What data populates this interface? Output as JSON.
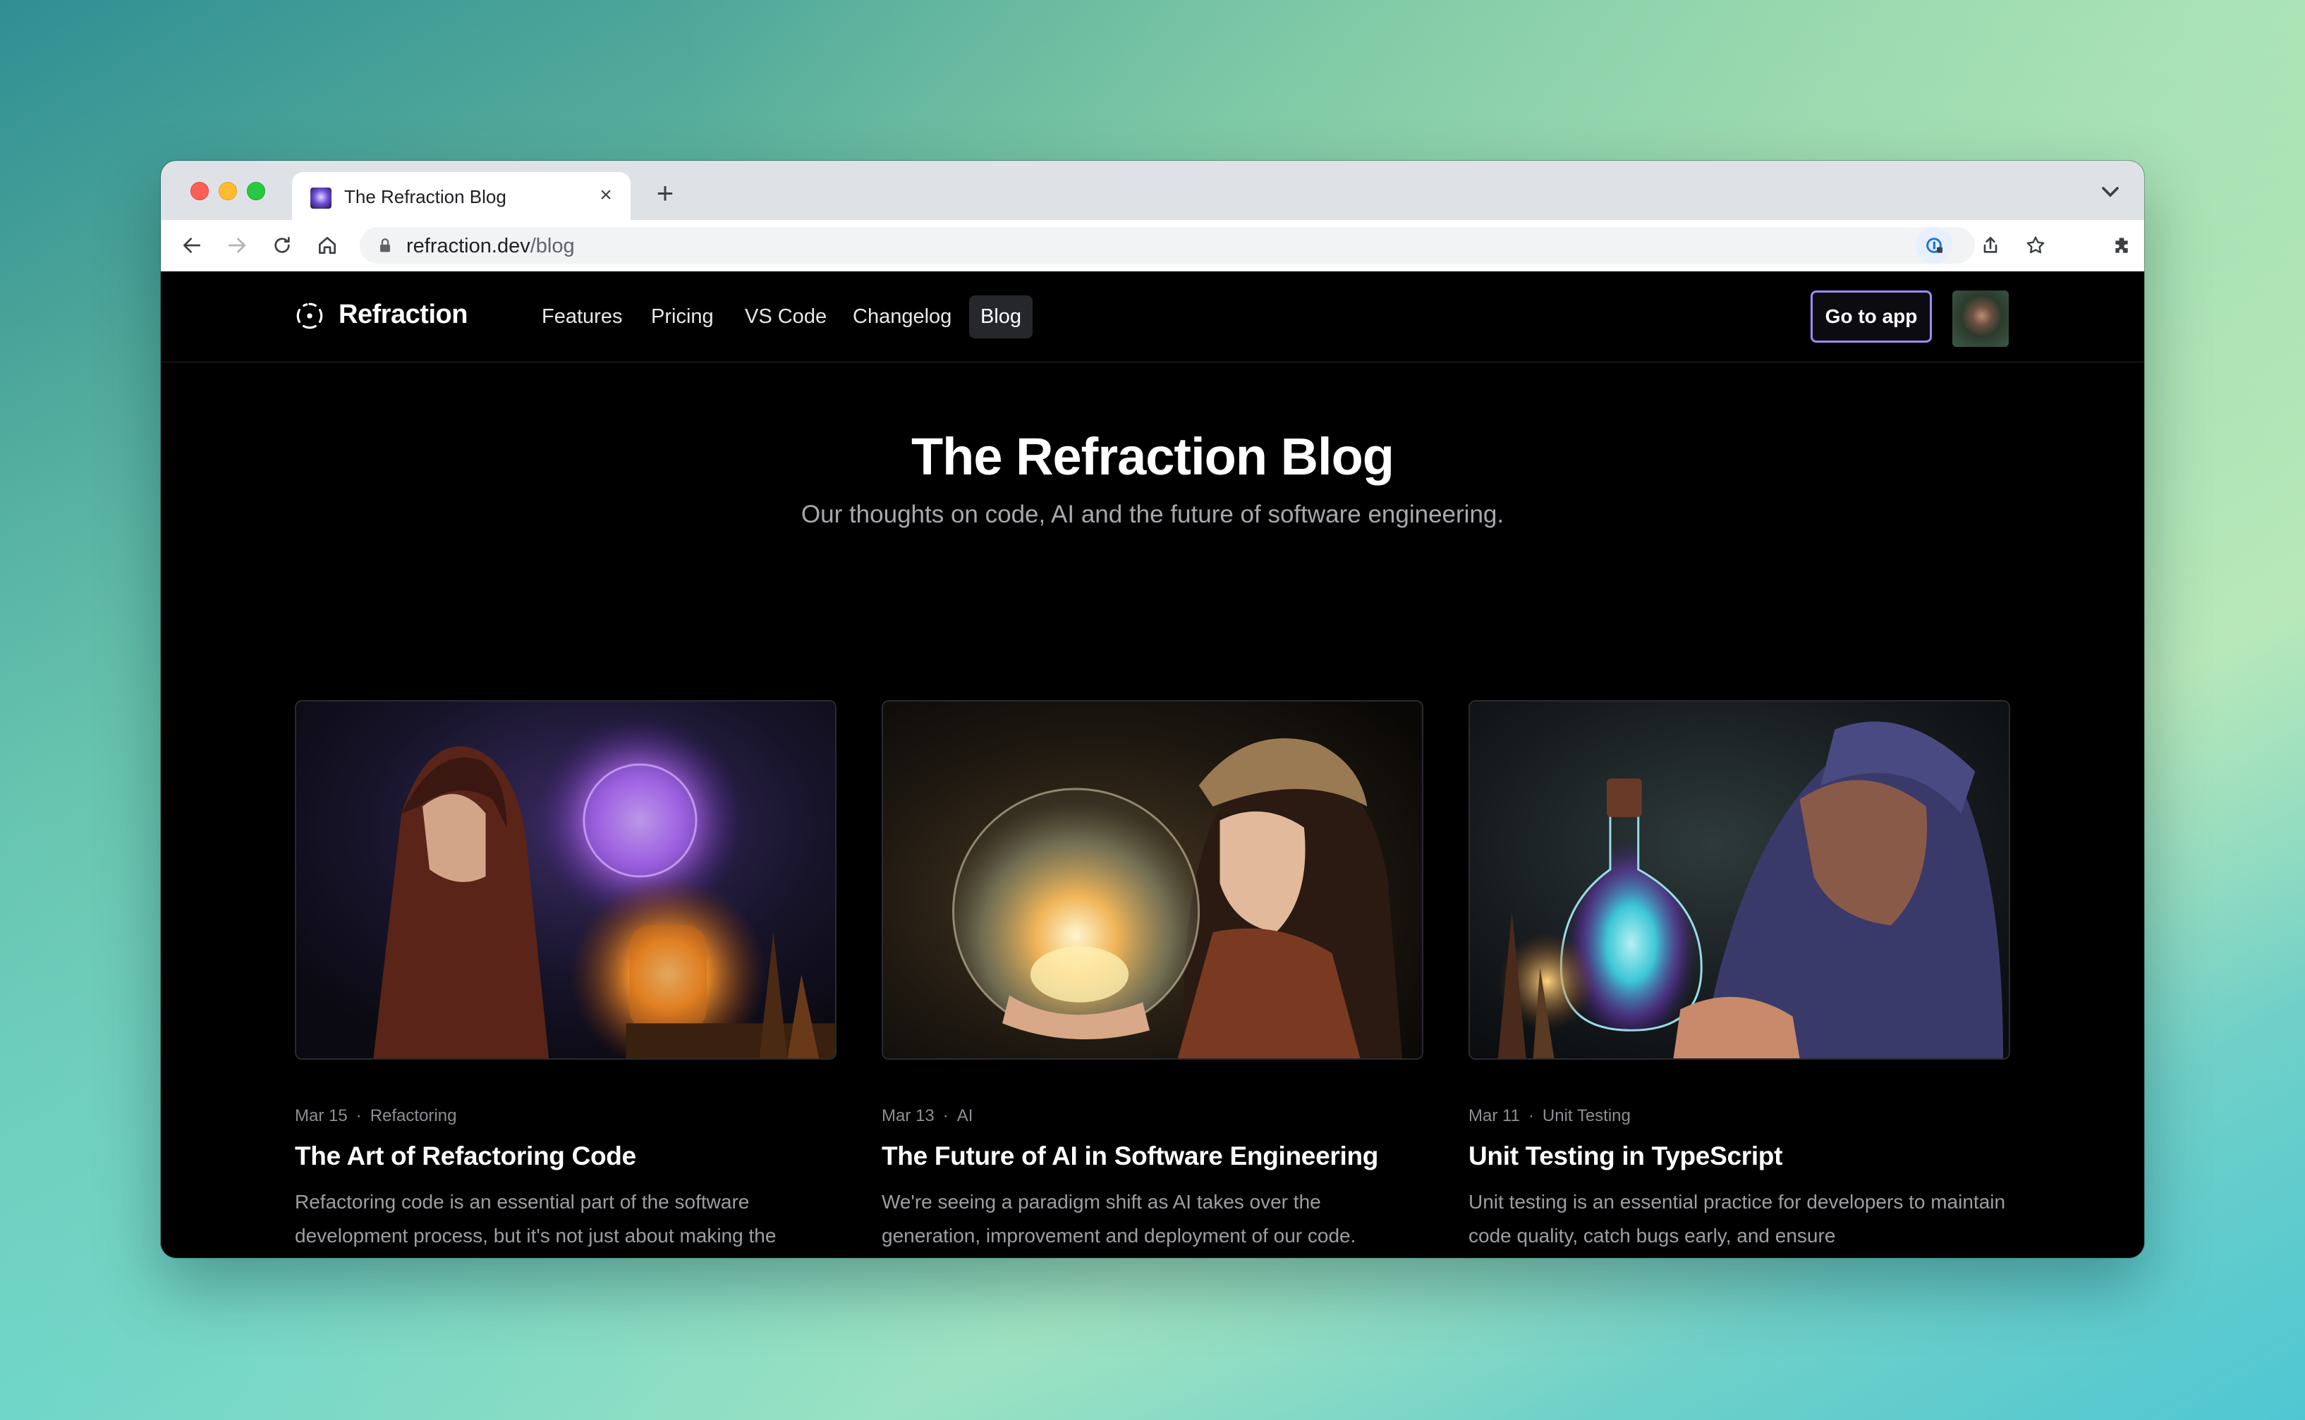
{
  "browser": {
    "tab_title": "The Refraction Blog",
    "url_domain": "refraction.dev",
    "url_path": "/blog"
  },
  "site": {
    "logo_text": "Refraction",
    "nav": [
      "Features",
      "Pricing",
      "VS Code",
      "Changelog",
      "Blog"
    ],
    "active_nav": "Blog",
    "cta": "Go to app",
    "accent_color": "#9b8cf5"
  },
  "hero": {
    "title": "The Refraction Blog",
    "subtitle": "Our thoughts on code, AI and the future of software engineering."
  },
  "posts": [
    {
      "date": "Mar 15",
      "category": "Refactoring",
      "title": "The Art of Refactoring Code",
      "excerpt": "Refactoring code is an essential part of the software development process, but it's not just about making the",
      "image": "hooded-sorceress-with-glowing-orb-icon"
    },
    {
      "date": "Mar 13",
      "category": "AI",
      "title": "The Future of AI in Software Engineering",
      "excerpt": "We're seeing a paradigm shift as AI takes over the generation, improvement and deployment of our code.",
      "image": "girl-holding-crystal-ball-icon"
    },
    {
      "date": "Mar 11",
      "category": "Unit Testing",
      "title": "Unit Testing in TypeScript",
      "excerpt": "Unit testing is an essential practice for developers to maintain code quality, catch bugs early, and ensure",
      "image": "alchemist-with-potion-bottle-icon"
    }
  ],
  "separator": "·"
}
